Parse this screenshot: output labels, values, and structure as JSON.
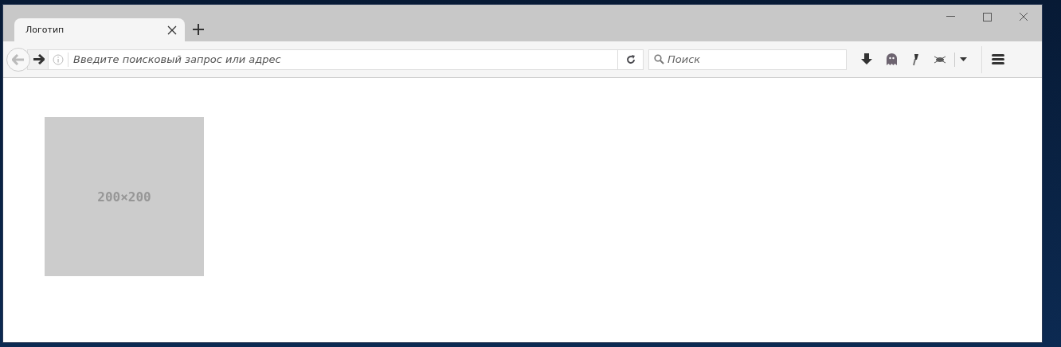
{
  "tabs": [
    {
      "label": "Логотип",
      "selected": true
    }
  ],
  "address_bar": {
    "placeholder": "Введите поисковый запрос или адрес"
  },
  "search": {
    "placeholder": "Поиск"
  },
  "page": {
    "placeholder_image": {
      "label": "200×200"
    }
  }
}
